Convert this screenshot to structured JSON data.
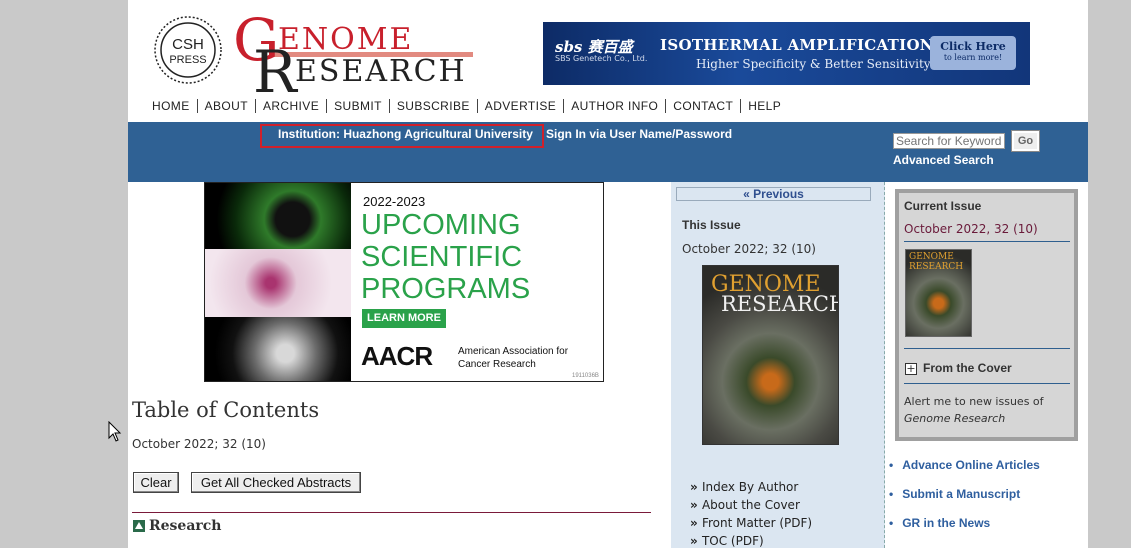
{
  "header": {
    "csh_logo_text": [
      "CSH",
      "PRESS"
    ],
    "logo": {
      "g": "G",
      "enome": "ENOME",
      "r": "R",
      "esearch": "ESEARCH"
    }
  },
  "banner": {
    "brand": "sbs 赛百盛",
    "brand_sub": "SBS Genetech Co., Ltd.",
    "line1": "ISOTHERMAL AMPLIFICATION",
    "line2": "Higher Specificity & Better Sensitivity",
    "click_main": "Click Here",
    "click_sub": "to learn more!"
  },
  "nav": [
    "HOME",
    "ABOUT",
    "ARCHIVE",
    "SUBMIT",
    "SUBSCRIBE",
    "ADVERTISE",
    "AUTHOR INFO",
    "CONTACT",
    "HELP"
  ],
  "bluebar": {
    "institution": "Institution: Huazhong Agricultural University",
    "signin": "Sign In via User Name/Password",
    "search_placeholder": "Search for Keyword:",
    "go_label": "Go",
    "advanced_search": "Advanced Search"
  },
  "ad": {
    "year": "2022-2023",
    "headline": [
      "UPCOMING",
      "SCIENTIFIC",
      "PROGRAMS"
    ],
    "learn_more": "LEARN MORE",
    "aacr": "AACR",
    "aacr_name": "American Association for Cancer Research",
    "code": "1911036B"
  },
  "toc": {
    "title": "Table of Contents",
    "date": "October 2022; 32 (10)",
    "clear_label": "Clear",
    "abstracts_label": "Get All Checked Abstracts",
    "section": "Research"
  },
  "middle": {
    "previous": "« Previous",
    "this_issue": "This Issue",
    "date": "October 2022; 32 (10)",
    "cover_title": [
      "GENOME",
      "RESEARCH"
    ],
    "links": [
      "Index By Author",
      "About the Cover",
      "Front Matter (PDF)",
      "TOC (PDF)"
    ]
  },
  "right": {
    "current_issue": "Current Issue",
    "date": "October 2022, 32 (10)",
    "thumb_title": "GENOME RESEARCH",
    "from_cover": "From the Cover",
    "alert_text": "Alert me to new issues of",
    "alert_journal": "Genome Research",
    "links": [
      "Advance Online Articles",
      "Submit a Manuscript",
      "GR in the News"
    ]
  },
  "colors": {
    "bluebar": "#2f6194",
    "logo_red": "#c8202c",
    "ad_green": "#2aa24a",
    "link_blue": "#2f5f9f"
  }
}
